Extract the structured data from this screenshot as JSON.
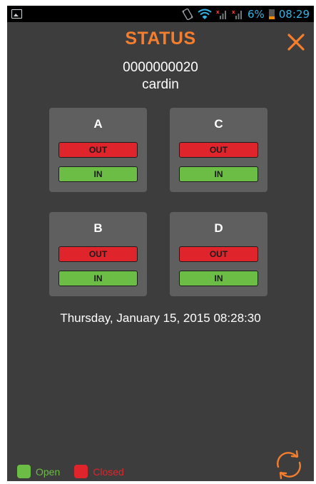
{
  "status_bar": {
    "battery_percent": "6%",
    "time": "08:29",
    "battery_level": 0.06,
    "colors": {
      "text": "#33b5e5",
      "battery": "#f08c00",
      "mute": "#ff4444"
    }
  },
  "header": {
    "title": "STATUS",
    "title_color": "#f47e2d"
  },
  "device": {
    "id": "0000000020",
    "name": "cardin"
  },
  "gates": [
    {
      "label": "A",
      "out_label": "OUT",
      "in_label": "IN"
    },
    {
      "label": "C",
      "out_label": "OUT",
      "in_label": "IN"
    },
    {
      "label": "B",
      "out_label": "OUT",
      "in_label": "IN"
    },
    {
      "label": "D",
      "out_label": "OUT",
      "in_label": "IN"
    }
  ],
  "datetime": "Thursday, January 15, 2015 08:28:30",
  "legend": {
    "open_label": "Open",
    "closed_label": "Closed",
    "open_color": "#6cbd45",
    "closed_color": "#e0242b"
  },
  "icons": {
    "close": "close-icon",
    "refresh": "refresh-icon",
    "image": "image-notification-icon",
    "vibrate": "vibrate-icon",
    "wifi": "wifi-icon",
    "signal": "signal-icon"
  }
}
